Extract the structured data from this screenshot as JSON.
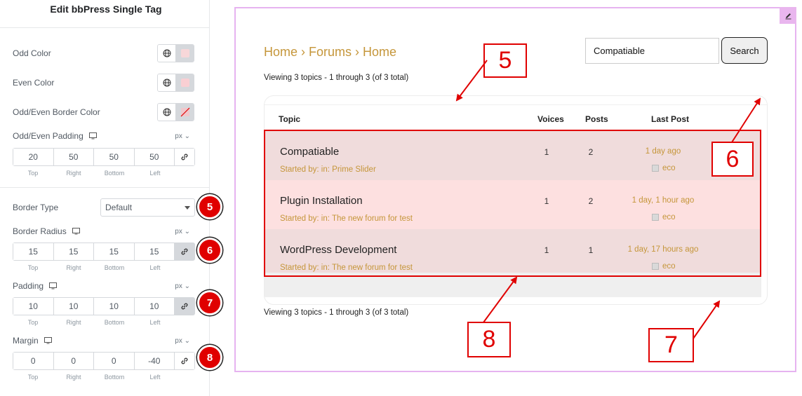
{
  "panel": {
    "title": "Edit bbPress Single Tag",
    "odd_color": "Odd Color",
    "even_color": "Even Color",
    "odd_even_border_color": "Odd/Even Border Color",
    "odd_even_padding": {
      "label": "Odd/Even Padding",
      "unit": "px",
      "values": [
        "20",
        "50",
        "50",
        "50"
      ]
    },
    "dim_labels": [
      "Top",
      "Right",
      "Bottom",
      "Left"
    ],
    "border_type": {
      "label": "Border Type",
      "value": "Default"
    },
    "border_radius": {
      "label": "Border Radius",
      "unit": "px",
      "values": [
        "15",
        "15",
        "15",
        "15"
      ]
    },
    "padding": {
      "label": "Padding",
      "unit": "px",
      "values": [
        "10",
        "10",
        "10",
        "10"
      ]
    },
    "margin": {
      "label": "Margin",
      "unit": "px",
      "values": [
        "0",
        "0",
        "0",
        "-40"
      ]
    },
    "badges": [
      "5",
      "6",
      "7",
      "8"
    ]
  },
  "colors": {
    "swatch": "#f7d7d9",
    "accent": "#c5963a",
    "badge": "#e00000",
    "row_odd": "#f0dcdc",
    "row_even": "#fde0e0"
  },
  "preview": {
    "breadcrumb": "Home › Forums › Home",
    "search_value": "Compatiable",
    "search_button": "Search",
    "viewing_text": "Viewing 3 topics - 1 through 3 (of 3 total)",
    "headers": {
      "topic": "Topic",
      "voices": "Voices",
      "posts": "Posts",
      "last_post": "Last Post"
    },
    "topics": [
      {
        "title": "Compatiable",
        "meta": "Started by: in: Prime Slider",
        "voices": "1",
        "posts": "2",
        "last": "1 day ago",
        "user": "eco"
      },
      {
        "title": "Plugin Installation",
        "meta": "Started by: in: The new forum for test",
        "voices": "1",
        "posts": "2",
        "last": "1 day, 1 hour ago",
        "user": "eco"
      },
      {
        "title": "WordPress Development",
        "meta": "Started by: in: The new forum for test",
        "voices": "1",
        "posts": "1",
        "last": "1 day, 17 hours ago",
        "user": "eco"
      }
    ],
    "callouts": [
      "5",
      "6",
      "7",
      "8"
    ]
  }
}
